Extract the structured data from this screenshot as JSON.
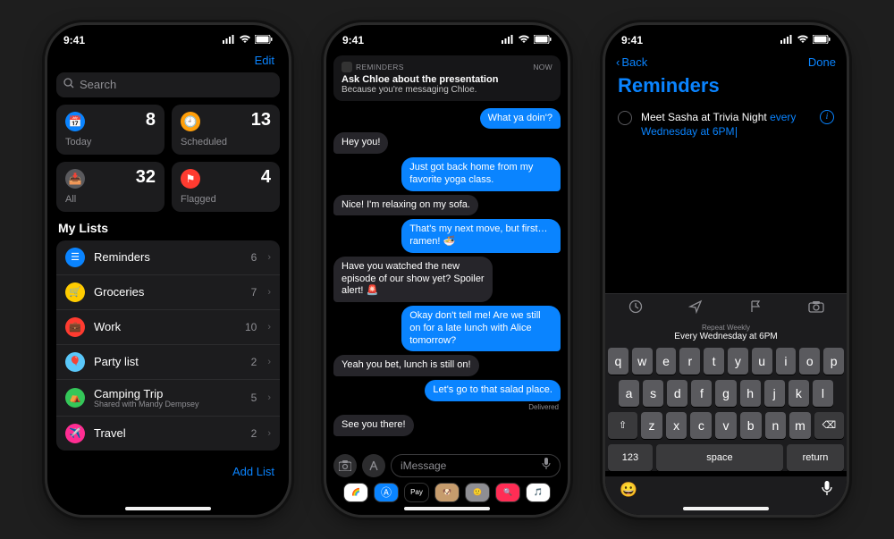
{
  "status": {
    "time": "9:41"
  },
  "phone1": {
    "edit": "Edit",
    "search_placeholder": "Search",
    "tiles": {
      "today": {
        "label": "Today",
        "count": "8",
        "color": "#0a84ff",
        "glyph": "📅"
      },
      "scheduled": {
        "label": "Scheduled",
        "count": "13",
        "color": "#ff9f0a",
        "glyph": "🕘"
      },
      "all": {
        "label": "All",
        "count": "32",
        "color": "#5a5a5e",
        "glyph": "📥"
      },
      "flagged": {
        "label": "Flagged",
        "count": "4",
        "color": "#ff3b30",
        "glyph": "⚑"
      }
    },
    "lists_header": "My Lists",
    "lists": [
      {
        "name": "Reminders",
        "count": "6",
        "color": "#0a84ff",
        "glyph": "☰",
        "sub": ""
      },
      {
        "name": "Groceries",
        "count": "7",
        "color": "#ffcc00",
        "glyph": "🛒",
        "sub": ""
      },
      {
        "name": "Work",
        "count": "10",
        "color": "#ff3b30",
        "glyph": "💼",
        "sub": ""
      },
      {
        "name": "Party list",
        "count": "2",
        "color": "#5ac8fa",
        "glyph": "🎈",
        "sub": ""
      },
      {
        "name": "Camping Trip",
        "count": "5",
        "color": "#34c759",
        "glyph": "⛺",
        "sub": "Shared with Mandy Dempsey"
      },
      {
        "name": "Travel",
        "count": "2",
        "color": "#ff2d92",
        "glyph": "✈️",
        "sub": ""
      }
    ],
    "add_list": "Add List"
  },
  "phone2": {
    "notif": {
      "app": "REMINDERS",
      "when": "now",
      "title": "Ask Chloe about the presentation",
      "body": "Because you're messaging Chloe."
    },
    "messages": [
      {
        "dir": "out",
        "text": "What ya doin'?"
      },
      {
        "dir": "in",
        "text": "Hey you!"
      },
      {
        "dir": "out",
        "text": "Just got back home from my favorite yoga class."
      },
      {
        "dir": "in",
        "text": "Nice! I'm relaxing on my sofa."
      },
      {
        "dir": "out",
        "text": "That's my next move, but first…ramen! 🍜"
      },
      {
        "dir": "in",
        "text": "Have you watched the new episode of our show yet? Spoiler alert! 🚨"
      },
      {
        "dir": "out",
        "text": "Okay don't tell me! Are we still on for a late lunch with Alice tomorrow?"
      },
      {
        "dir": "in",
        "text": "Yeah you bet, lunch is still on!"
      },
      {
        "dir": "out",
        "text": "Let's go to that salad place."
      },
      {
        "dir": "in",
        "text": "See you there!"
      }
    ],
    "delivered": "Delivered",
    "compose_placeholder": "iMessage",
    "app_chips": [
      {
        "name": "photos",
        "color": "#fff",
        "glyph": "🌈"
      },
      {
        "name": "appstore",
        "color": "#0a84ff",
        "glyph": "Ⓐ"
      },
      {
        "name": "applepay",
        "color": "#000",
        "glyph": "Pay"
      },
      {
        "name": "memoji1",
        "color": "#c69c6d",
        "glyph": "🐶"
      },
      {
        "name": "memoji2",
        "color": "#8e8e93",
        "glyph": "🙂"
      },
      {
        "name": "search",
        "color": "#ff2d55",
        "glyph": "🔍"
      },
      {
        "name": "music",
        "color": "#fff",
        "glyph": "🎵"
      }
    ]
  },
  "phone3": {
    "back": "Back",
    "done": "Done",
    "title": "Reminders",
    "reminder": {
      "text": "Meet Sasha at Trivia Night",
      "highlight": "every Wednesday at 6PM"
    },
    "kb_hint_label": "Repeat Weekly",
    "kb_hint_value": "Every Wednesday at 6PM",
    "keys": {
      "row1": [
        "q",
        "w",
        "e",
        "r",
        "t",
        "y",
        "u",
        "i",
        "o",
        "p"
      ],
      "row2": [
        "a",
        "s",
        "d",
        "f",
        "g",
        "h",
        "j",
        "k",
        "l"
      ],
      "row3": [
        "z",
        "x",
        "c",
        "v",
        "b",
        "n",
        "m"
      ],
      "shift": "⇧",
      "del": "⌫",
      "num": "123",
      "space": "space",
      "return": "return"
    }
  }
}
